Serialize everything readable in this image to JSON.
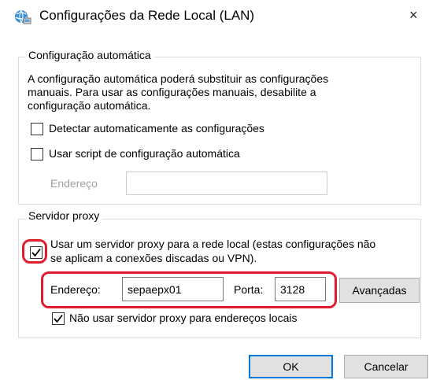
{
  "window": {
    "title": "Configurações da Rede Local (LAN)",
    "close_glyph": "×"
  },
  "auto_config": {
    "legend": "Configuração automática",
    "description_line1": "A configuração automática poderá substituir as configurações",
    "description_line2": "manuais. Para usar as configurações manuais, desabilite a",
    "description_line3": "configuração automática.",
    "detect_label": "Detectar automaticamente as configurações",
    "detect_checked": false,
    "script_label": "Usar script de configuração automática",
    "script_checked": false,
    "address_label": "Endereço",
    "address_value": ""
  },
  "proxy": {
    "legend": "Servidor proxy",
    "use_proxy_line1": "Usar um servidor proxy para a rede local (estas configurações não",
    "use_proxy_line2": "se aplicam a conexões discadas ou VPN).",
    "use_proxy_checked": true,
    "address_label": "Endereço:",
    "address_value": "sepaepx01",
    "port_label": "Porta:",
    "port_value": "3128",
    "advanced_label": "Avançadas",
    "bypass_label": "Não usar servidor proxy para endereços locais",
    "bypass_checked": true
  },
  "buttons": {
    "ok_label": "OK",
    "cancel_label": "Cancelar"
  },
  "colors": {
    "annotation_red": "#e01d2c",
    "default_button_border": "#0078d7",
    "button_face": "#e1e1e1"
  },
  "icons": {
    "title": "network-globe-icon",
    "check": "checkmark-icon"
  }
}
